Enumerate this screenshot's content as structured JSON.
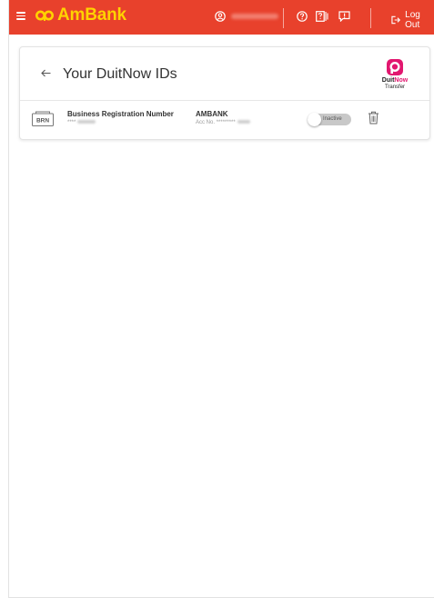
{
  "header": {
    "brand": "AmBank",
    "logout_label": "Log Out",
    "icons": [
      "menu-icon",
      "user-icon",
      "help-icon",
      "guide-icon",
      "feedback-icon",
      "logout-icon"
    ],
    "colors": {
      "bar": "#e8412c",
      "brand": "#ffd200"
    }
  },
  "page": {
    "title": "Your DuitNow IDs",
    "logo": {
      "brand_a": "Duit",
      "brand_b": "Now",
      "sub": "Transfer"
    }
  },
  "ids": [
    {
      "icon_text": "BRN",
      "type_label": "Business Registration Number",
      "id_masked": "****",
      "bank": "AMBANK",
      "account_prefix": "Acc No.",
      "account_masked": "*********",
      "status": "Inactive",
      "active": false
    }
  ]
}
